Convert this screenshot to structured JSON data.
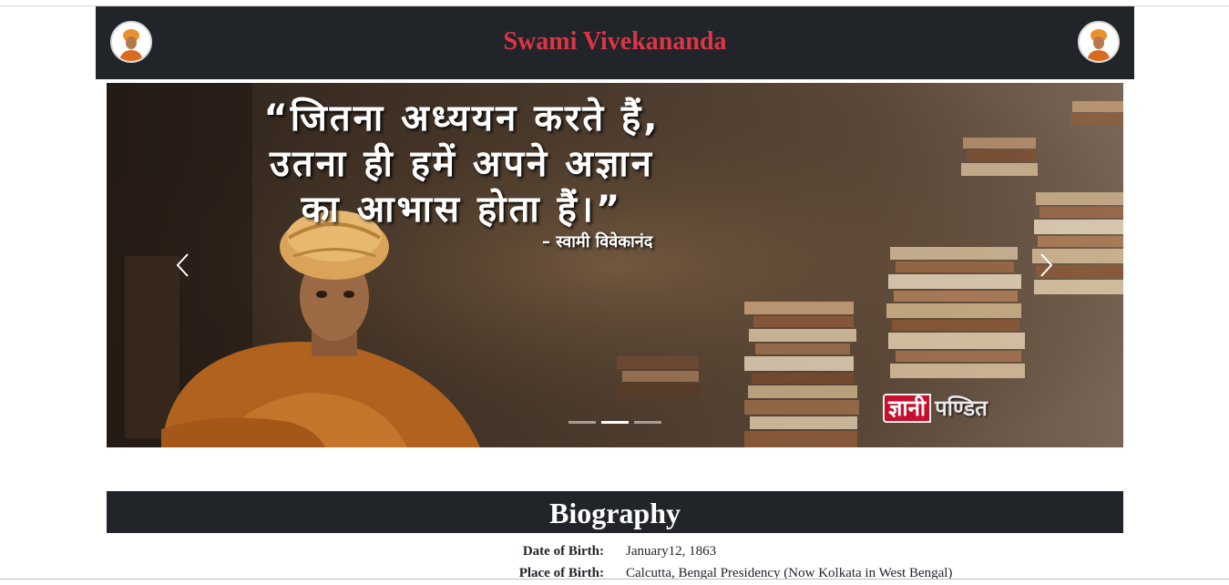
{
  "header": {
    "title": "Swami Vivekananda",
    "avatar_left": "vivekananda-portrait",
    "avatar_right": "vivekananda-portrait",
    "background": "#212529",
    "title_color": "#dc3545"
  },
  "carousel": {
    "quote_lines": [
      "“जितना अध्ययन करते हैं,",
      "उतना ही हमें अपने अज्ञान",
      "का आभास होता हैं।”"
    ],
    "quote_author": "– स्वामी विवेकानंद",
    "watermark_part1": "ज्ञानी",
    "watermark_part2": "पण्डित",
    "prev_icon": "chevron-left-icon",
    "next_icon": "chevron-right-icon",
    "indicator_count": 3,
    "active_indicator": 2
  },
  "biography": {
    "heading": "Biography",
    "rows": [
      {
        "label": "Date of Birth:",
        "value": "January12, 1863"
      },
      {
        "label": "Place of Birth:",
        "value": "Calcutta, Bengal Presidency (Now Kolkata in West Bengal)"
      }
    ]
  }
}
